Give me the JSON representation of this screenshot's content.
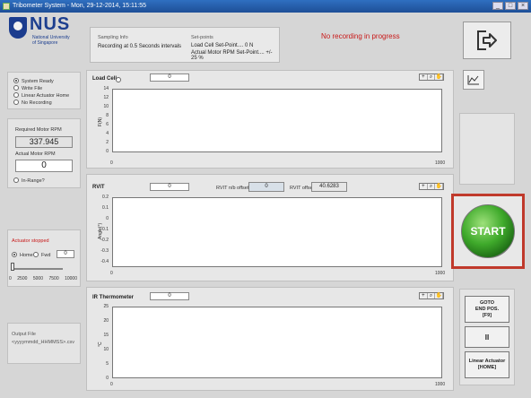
{
  "window": {
    "title": "Tribometer System - Mon, 29-12-2014, 15:11:55",
    "buttons": [
      "_",
      "□",
      "×"
    ]
  },
  "logo": {
    "name": "NUS",
    "line1": "National University",
    "line2": "of Singapore"
  },
  "sampling": {
    "header": "Sampling Info",
    "text": "Recording at 0.5 Seconds intervals",
    "setpoints_header": "Set-points",
    "load_cell": "Load Cell Set-Point.... 0 N",
    "motor_rpm": "Actual Motor RPM Set-Point.... +/- 25 %"
  },
  "status": "No recording in progress",
  "states": {
    "items": [
      {
        "label": "System Ready",
        "on": true
      },
      {
        "label": "Write File",
        "on": false
      },
      {
        "label": "Linear Actuator Home",
        "on": false
      },
      {
        "label": "No Recording",
        "on": false
      }
    ]
  },
  "motor": {
    "required_label": "Required Motor RPM",
    "required_value": "337.945",
    "actual_label": "Actual Motor RPM",
    "actual_value": "0",
    "inrange_label": "In-Range?"
  },
  "actuator": {
    "status": "Actuator stopped",
    "home_label": "Home",
    "fwd_label": "Fwd",
    "value": "0",
    "slider_ticks": [
      "0",
      "2500",
      "5000",
      "7500",
      "10000"
    ],
    "slider_value": 0
  },
  "output": {
    "label": "Output File",
    "value": "<yyyymmdd_HHMMSS>.csv"
  },
  "charts": [
    {
      "title": "Load Cell",
      "value": "0",
      "ylabel": "F(N)",
      "yticks": [
        "14",
        "12",
        "10",
        "8",
        "6",
        "4",
        "2",
        "0"
      ],
      "xticks": [
        "0",
        "1000"
      ]
    },
    {
      "title": "RVIT",
      "value": "0",
      "nb_label": "RVIT n/b offset",
      "nb_value": "0",
      "offset_label": "RVIT offset",
      "offset_value": "40.6283",
      "ylabel": "Angle(°)",
      "yticks": [
        "0.2",
        "0.1",
        "0",
        "-0.1",
        "-0.2",
        "-0.3",
        "-0.4"
      ],
      "xticks": [
        "0",
        "1000"
      ]
    },
    {
      "title": "IR Thermometer",
      "value": "0",
      "ylabel": "°C",
      "yticks": [
        "25",
        "20",
        "15",
        "10",
        "5",
        "0"
      ],
      "xticks": [
        "0",
        "1000"
      ]
    }
  ],
  "controls": {
    "start": "START",
    "goto_line1": "GOTO",
    "goto_line2": "END POS.",
    "goto_line3": "[F9]",
    "pause": "II",
    "home_line1": "Linear Actuator",
    "home_line2": "[HOME]"
  }
}
